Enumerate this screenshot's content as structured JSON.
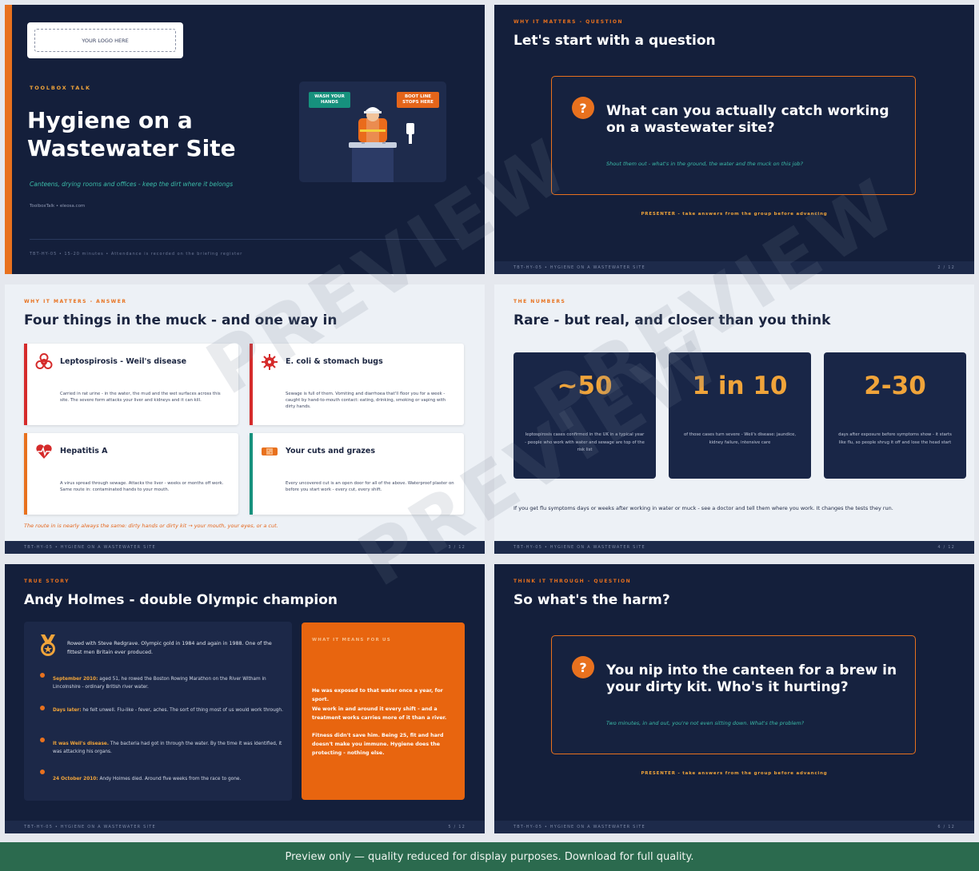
{
  "colors": {
    "navy": "#141f3b",
    "orange": "#e8711e",
    "amber": "#f0a43a",
    "teal": "#3bbca8",
    "banner": "#2b6a4e"
  },
  "footer_text": "TBT-HY-05 • HYGIENE ON A WASTEWATER SITE",
  "slide1": {
    "logo": "YOUR LOGO HERE",
    "kicker": "TOOLBOX TALK",
    "title": "Hygiene on a Wastewater Site",
    "subtitle": "Canteens, drying rooms and offices - keep the dirt where it belongs",
    "meta": "ToolboxTalk • eleosa.com",
    "foot": "TBT-HY-05 • 15-20 minutes • Attendance is recorded on the briefing register",
    "sign_left": "WASH YOUR HANDS",
    "sign_right": "BOOT LINE STOPS HERE"
  },
  "slide2": {
    "kicker": "WHY IT MATTERS - QUESTION",
    "title": "Let's start with a question",
    "question": "What can you actually catch working on a wastewater site?",
    "hint": "Shout them out - what's in the ground, the water and the muck on this job?",
    "presenter": "PRESENTER - take answers from the group before advancing",
    "page": "2 / 12"
  },
  "slide3": {
    "kicker": "WHY IT MATTERS - ANSWER",
    "title": "Four things in the muck - and one way in",
    "cards": [
      {
        "title": "Leptospirosis - Weil's disease",
        "icon": "biohazard-icon",
        "color": "#d52b2b",
        "body": "Carried in rat urine - in the water, the mud and the wet surfaces across this site. The severe form attacks your liver and kidneys and it can kill."
      },
      {
        "title": "E. coli & stomach bugs",
        "icon": "virus-icon",
        "color": "#d52b2b",
        "body": "Sewage is full of them. Vomiting and diarrhoea that'll floor you for a week - caught by hand-to-mouth contact: eating, drinking, smoking or vaping with dirty hands."
      },
      {
        "title": "Hepatitis A",
        "icon": "heart-pulse-icon",
        "color": "#e8711e",
        "body": "A virus spread through sewage. Attacks the liver - weeks or months off work. Same route in: contaminated hands to your mouth."
      },
      {
        "title": "Your cuts and grazes",
        "icon": "plaster-icon",
        "color": "#16917d",
        "body": "Every uncovered cut is an open door for all of the above. Waterproof plaster on before you start work - every cut, every shift."
      }
    ],
    "route": "The route in is nearly always the same: dirty hands or dirty kit → your mouth, your eyes, or a cut.",
    "page": "3 / 12"
  },
  "slide4": {
    "kicker": "THE NUMBERS",
    "title": "Rare - but real, and closer than you think",
    "stats": [
      {
        "value": "~50",
        "caption": "leptospirosis cases confirmed in the UK in a typical year - people who work with water and sewage are top of the risk list"
      },
      {
        "value": "1 in 10",
        "caption": "of those cases turn severe - Weil's disease: jaundice, kidney failure, intensive care"
      },
      {
        "value": "2-30",
        "caption": "days after exposure before symptoms show - it starts like flu, so people shrug it off and lose the head start"
      }
    ],
    "note": "If you get flu symptoms days or weeks after working in water or muck - see a doctor and tell them where you work. It changes the tests they run.",
    "page": "4 / 12"
  },
  "slide5": {
    "kicker": "TRUE STORY",
    "title": "Andy Holmes - double Olympic champion",
    "intro": "Rowed with Steve Redgrave. Olympic gold in 1984 and again in 1988. One of the fittest men Britain ever produced.",
    "timeline": [
      {
        "key": "September 2010:",
        "text": " aged 51, he rowed the Boston Rowing Marathon on the River Witham in Lincolnshire - ordinary British river water."
      },
      {
        "key": "Days later:",
        "text": " he felt unwell. Flu-like - fever, aches. The sort of thing most of us would work through."
      },
      {
        "key": "It was Weil's disease.",
        "text": " The bacteria had got in through the water. By the time it was identified, it was attacking his organs."
      },
      {
        "key": "24 October 2010:",
        "text": " Andy Holmes died. Around five weeks from the race to gone."
      }
    ],
    "meaning_kicker": "WHAT IT MEANS FOR US",
    "meaning": [
      "He was exposed to that water once a year, for sport.",
      "We work in and around it every shift - and a treatment works carries more of it than a river.",
      "Fitness didn't save him. Being 25, fit and hard doesn't make you immune. Hygiene does the protecting - nothing else."
    ],
    "page": "5 / 12"
  },
  "slide6": {
    "kicker": "THINK IT THROUGH - QUESTION",
    "title": "So what's the harm?",
    "question": "You nip into the canteen for a brew in your dirty kit. Who's it hurting?",
    "hint": "Two minutes, in and out, you're not even sitting down. What's the problem?",
    "presenter": "PRESENTER - take answers from the group before advancing",
    "page": "6 / 12"
  },
  "watermark": "PREVIEW",
  "banner": "Preview only  —  quality reduced for display purposes.  Download for full quality."
}
